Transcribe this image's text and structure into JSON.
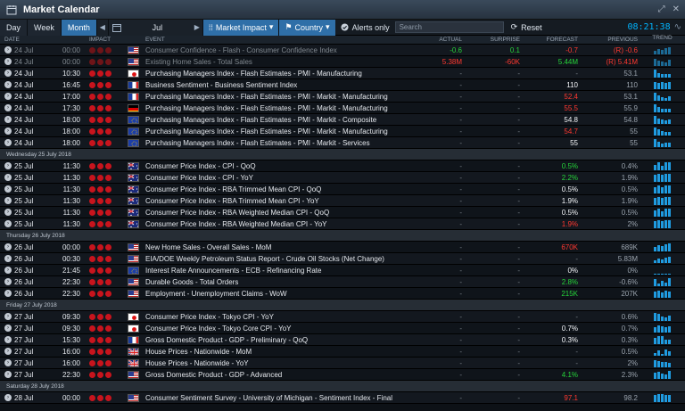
{
  "window": {
    "title": "Market Calendar",
    "min_label": "⤢",
    "close_label": "✕"
  },
  "toolbar": {
    "tabs": [
      {
        "label": "Day",
        "active": false
      },
      {
        "label": "Week",
        "active": false
      },
      {
        "label": "Month",
        "active": true
      }
    ],
    "date_value": "Jul",
    "market_impact_label": "Market Impact",
    "country_label": "Country",
    "alerts_label": "Alerts only",
    "search_placeholder": "Search",
    "reset_label": "Reset",
    "clock": "08:21:38"
  },
  "columns": {
    "date": "DATE",
    "impact": "IMPACT",
    "event": "EVENT",
    "actual": "ACTUAL",
    "surprise": "SURPRISE",
    "forecast": "FORECAST",
    "previous": "PREVIOUS",
    "trend": "TREND"
  },
  "colors": {
    "accent": "#2f6fa8",
    "impact_red": "#c8141d",
    "positive": "#26d43a",
    "negative": "#ff3830",
    "trend": "#1f9be0"
  },
  "rows": [
    {
      "type": "event",
      "date": "24 Jul",
      "time": "00:00",
      "flag": "us",
      "event": "Consumer Confidence - Flash - Consumer Confidence Index",
      "actual": "-0.6",
      "actual_c": "green",
      "surprise": "0.1",
      "surprise_c": "green",
      "forecast": "-0.7",
      "forecast_c": "red",
      "previous": "(R) -0.6",
      "previous_c": "red",
      "dim": true,
      "trend": [
        4,
        6,
        5,
        7,
        8
      ]
    },
    {
      "type": "event",
      "date": "24 Jul",
      "time": "00:00",
      "flag": "us",
      "event": "Existing Home Sales - Total Sales",
      "actual": "5.38M",
      "actual_c": "red",
      "surprise": "-60K",
      "surprise_c": "red",
      "forecast": "5.44M",
      "forecast_c": "green",
      "previous": "(R) 5.41M",
      "previous_c": "red",
      "dim": true,
      "trend": [
        8,
        6,
        5,
        4,
        7
      ]
    },
    {
      "type": "event",
      "date": "24 Jul",
      "time": "10:30",
      "flag": "jp",
      "event": "Purchasing Managers Index - Flash Estimates - PMI - Manufacturing",
      "actual": "-",
      "surprise": "-",
      "forecast": "-",
      "previous": "53.1",
      "previous_c": "grey",
      "trend": [
        9,
        5,
        4,
        4,
        4
      ]
    },
    {
      "type": "event",
      "date": "24 Jul",
      "time": "16:45",
      "flag": "fr",
      "event": "Business Sentiment - Business Sentiment Index",
      "actual": "-",
      "surprise": "-",
      "forecast": "110",
      "forecast_c": "white",
      "previous": "110",
      "previous_c": "grey",
      "trend": [
        8,
        7,
        8,
        7,
        8
      ]
    },
    {
      "type": "event",
      "date": "24 Jul",
      "time": "17:00",
      "flag": "fr",
      "event": "Purchasing Managers Index - Flash Estimates - PMI - Markit - Manufacturing",
      "actual": "-",
      "surprise": "-",
      "forecast": "52.4",
      "forecast_c": "red",
      "previous": "53.1",
      "previous_c": "grey",
      "trend": [
        9,
        6,
        4,
        3,
        5
      ]
    },
    {
      "type": "event",
      "date": "24 Jul",
      "time": "17:30",
      "flag": "de",
      "event": "Purchasing Managers Index - Flash Estimates - PMI - Markit - Manufacturing",
      "actual": "-",
      "surprise": "-",
      "forecast": "55.5",
      "forecast_c": "red",
      "previous": "55.9",
      "previous_c": "grey",
      "trend": [
        9,
        6,
        4,
        4,
        4
      ]
    },
    {
      "type": "event",
      "date": "24 Jul",
      "time": "18:00",
      "flag": "eu",
      "event": "Purchasing Managers Index - Flash Estimates - PMI - Markit - Composite",
      "actual": "-",
      "surprise": "-",
      "forecast": "54.8",
      "forecast_c": "white",
      "previous": "54.8",
      "previous_c": "grey",
      "trend": [
        9,
        6,
        5,
        4,
        5
      ]
    },
    {
      "type": "event",
      "date": "24 Jul",
      "time": "18:00",
      "flag": "eu",
      "event": "Purchasing Managers Index - Flash Estimates - PMI - Markit - Manufacturing",
      "actual": "-",
      "surprise": "-",
      "forecast": "54.7",
      "forecast_c": "red",
      "previous": "55",
      "previous_c": "grey",
      "trend": [
        9,
        7,
        5,
        4,
        4
      ]
    },
    {
      "type": "event",
      "date": "24 Jul",
      "time": "18:00",
      "flag": "eu",
      "event": "Purchasing Managers Index - Flash Estimates - PMI - Markit - Services",
      "actual": "-",
      "surprise": "-",
      "forecast": "55",
      "forecast_c": "white",
      "previous": "55",
      "previous_c": "grey",
      "trend": [
        9,
        6,
        4,
        5,
        5
      ]
    },
    {
      "type": "day",
      "label": "Wednesday 25 July 2018"
    },
    {
      "type": "event",
      "date": "25 Jul",
      "time": "11:30",
      "flag": "au",
      "event": "Consumer Price Index - CPI - QoQ",
      "actual": "-",
      "surprise": "-",
      "forecast": "0.5%",
      "forecast_c": "green",
      "previous": "0.4%",
      "previous_c": "grey",
      "trend": [
        6,
        9,
        5,
        9,
        9
      ]
    },
    {
      "type": "event",
      "date": "25 Jul",
      "time": "11:30",
      "flag": "au",
      "event": "Consumer Price Index - CPI - YoY",
      "actual": "-",
      "surprise": "-",
      "forecast": "2.2%",
      "forecast_c": "green",
      "previous": "1.9%",
      "previous_c": "grey",
      "trend": [
        8,
        9,
        8,
        9,
        9
      ]
    },
    {
      "type": "event",
      "date": "25 Jul",
      "time": "11:30",
      "flag": "au",
      "event": "Consumer Price Index - RBA Trimmed Mean CPI - QoQ",
      "actual": "-",
      "surprise": "-",
      "forecast": "0.5%",
      "forecast_c": "white",
      "previous": "0.5%",
      "previous_c": "grey",
      "trend": [
        7,
        9,
        7,
        9,
        9
      ]
    },
    {
      "type": "event",
      "date": "25 Jul",
      "time": "11:30",
      "flag": "au",
      "event": "Consumer Price Index - RBA Trimmed Mean CPI - YoY",
      "actual": "-",
      "surprise": "-",
      "forecast": "1.9%",
      "forecast_c": "white",
      "previous": "1.9%",
      "previous_c": "grey",
      "trend": [
        8,
        9,
        8,
        9,
        9
      ]
    },
    {
      "type": "event",
      "date": "25 Jul",
      "time": "11:30",
      "flag": "au",
      "event": "Consumer Price Index - RBA Weighted Median CPI - QoQ",
      "actual": "-",
      "surprise": "-",
      "forecast": "0.5%",
      "forecast_c": "white",
      "previous": "0.5%",
      "previous_c": "grey",
      "trend": [
        7,
        9,
        6,
        9,
        9
      ]
    },
    {
      "type": "event",
      "date": "25 Jul",
      "time": "11:30",
      "flag": "au",
      "event": "Consumer Price Index - RBA Weighted Median CPI - YoY",
      "actual": "-",
      "surprise": "-",
      "forecast": "1.9%",
      "forecast_c": "red",
      "previous": "2%",
      "previous_c": "grey",
      "trend": [
        8,
        9,
        8,
        9,
        9
      ]
    },
    {
      "type": "day",
      "label": "Thursday 26 July 2018"
    },
    {
      "type": "event",
      "date": "26 Jul",
      "time": "00:00",
      "flag": "us",
      "event": "New Home Sales - Overall Sales - MoM",
      "actual": "-",
      "surprise": "-",
      "forecast": "670K",
      "forecast_c": "red",
      "previous": "689K",
      "previous_c": "grey",
      "trend": [
        5,
        7,
        6,
        8,
        9
      ]
    },
    {
      "type": "event",
      "date": "26 Jul",
      "time": "00:30",
      "flag": "us",
      "event": "EIA/DOE Weekly Petroleum Status Report - Crude Oil Stocks (Net Change)",
      "actual": "-",
      "surprise": "-",
      "forecast": "-",
      "previous": "5.83M",
      "previous_c": "grey",
      "trend": [
        3,
        5,
        4,
        6,
        7
      ]
    },
    {
      "type": "event",
      "date": "26 Jul",
      "time": "21:45",
      "flag": "eu",
      "event": "Interest Rate Announcements - ECB - Refinancing Rate",
      "actual": "-",
      "surprise": "-",
      "forecast": "0%",
      "forecast_c": "white",
      "previous": "0%",
      "previous_c": "grey",
      "trend": [
        1,
        1,
        1,
        1,
        1
      ]
    },
    {
      "type": "event",
      "date": "26 Jul",
      "time": "22:30",
      "flag": "us",
      "event": "Durable Goods - Total Orders",
      "actual": "-",
      "surprise": "-",
      "forecast": "2.8%",
      "forecast_c": "green",
      "previous": "-0.6%",
      "previous_c": "grey",
      "trend": [
        8,
        3,
        6,
        4,
        9
      ]
    },
    {
      "type": "event",
      "date": "26 Jul",
      "time": "22:30",
      "flag": "us",
      "event": "Employment - Unemployment Claims - WoW",
      "actual": "-",
      "surprise": "-",
      "forecast": "215K",
      "forecast_c": "green",
      "previous": "207K",
      "previous_c": "grey",
      "trend": [
        7,
        8,
        6,
        8,
        7
      ]
    },
    {
      "type": "day",
      "label": "Friday 27 July 2018"
    },
    {
      "type": "event",
      "date": "27 Jul",
      "time": "09:30",
      "flag": "jp",
      "event": "Consumer Price Index - Tokyo CPI - YoY",
      "actual": "-",
      "surprise": "-",
      "forecast": "-",
      "previous": "0.6%",
      "previous_c": "grey",
      "trend": [
        9,
        8,
        5,
        4,
        6
      ]
    },
    {
      "type": "event",
      "date": "27 Jul",
      "time": "09:30",
      "flag": "jp",
      "event": "Consumer Price Index - Tokyo Core CPI - YoY",
      "actual": "-",
      "surprise": "-",
      "forecast": "0.7%",
      "forecast_c": "white",
      "previous": "0.7%",
      "previous_c": "grey",
      "trend": [
        6,
        8,
        7,
        6,
        7
      ]
    },
    {
      "type": "event",
      "date": "27 Jul",
      "time": "15:30",
      "flag": "fr",
      "event": "Gross Domestic Product - GDP - Preliminary - QoQ",
      "actual": "-",
      "surprise": "-",
      "forecast": "0.3%",
      "forecast_c": "white",
      "previous": "0.3%",
      "previous_c": "grey",
      "trend": [
        7,
        9,
        9,
        5,
        5
      ]
    },
    {
      "type": "event",
      "date": "27 Jul",
      "time": "16:00",
      "flag": "uk",
      "event": "House Prices - Nationwide - MoM",
      "actual": "-",
      "surprise": "-",
      "forecast": "-",
      "previous": "0.5%",
      "previous_c": "grey",
      "trend": [
        3,
        6,
        2,
        7,
        5
      ]
    },
    {
      "type": "event",
      "date": "27 Jul",
      "time": "16:00",
      "flag": "uk",
      "event": "House Prices - Nationwide - YoY",
      "actual": "-",
      "surprise": "-",
      "forecast": "-",
      "previous": "2%",
      "previous_c": "grey",
      "trend": [
        8,
        7,
        6,
        6,
        5
      ]
    },
    {
      "type": "event",
      "date": "27 Jul",
      "time": "22:30",
      "flag": "us",
      "event": "Gross Domestic Product - GDP - Advanced",
      "actual": "-",
      "surprise": "-",
      "forecast": "4.1%",
      "forecast_c": "green",
      "previous": "2.3%",
      "previous_c": "grey",
      "trend": [
        7,
        8,
        6,
        5,
        9
      ]
    },
    {
      "type": "day",
      "label": "Saturday 28 July 2018"
    },
    {
      "type": "event",
      "date": "28 Jul",
      "time": "00:00",
      "flag": "us",
      "event": "Consumer Sentiment Survey - University of Michigan - Sentiment Index - Final",
      "actual": "-",
      "surprise": "-",
      "forecast": "97.1",
      "forecast_c": "red",
      "previous": "98.2",
      "previous_c": "grey",
      "trend": [
        8,
        9,
        9,
        8,
        8
      ]
    }
  ]
}
